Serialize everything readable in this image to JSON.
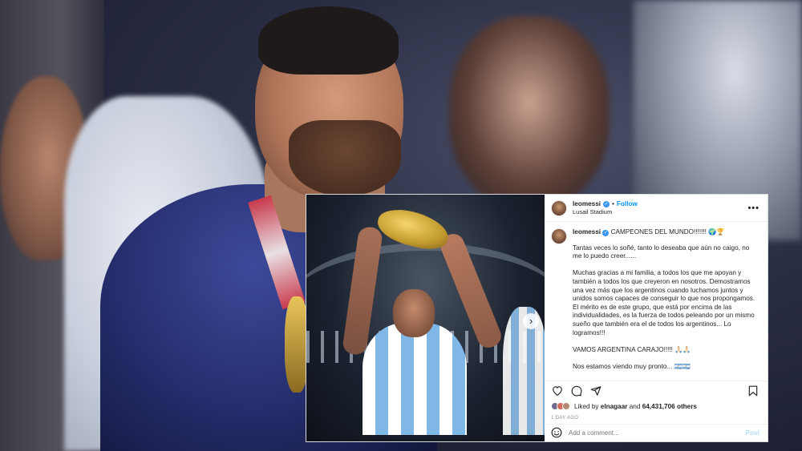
{
  "post": {
    "username": "leomessi",
    "follow_label": "Follow",
    "dot_separator": "•",
    "location": "Lusail Stadium",
    "more_icon": "•••",
    "caption_first": "CAMPEONES DEL MUNDO!!!!!!! 🌍🏆",
    "paragraphs": [
      "Tantas veces lo soñé, tanto lo deseaba que aún no caigo, no me lo puedo creer......",
      "Muchas gracias a mi familia, a todos los que me apoyan y también a todos los que creyeron en nosotros. Demostramos una vez más que los argentinos cuando luchamos juntos y unidos somos capaces de conseguir lo que nos propongamos. El mérito es de este grupo, que está por encima de las individualidades, es la fuerza de todos peleando por un mismo sueño que también era el de todos los argentinos... Lo logramos!!!",
      "VAMOS ARGENTINA CARAJO!!!!! 🙏🏻🙏🏻",
      "Nos estamos viendo muy pronto... 🇦🇷🇦🇷"
    ],
    "likes_prefix": "Liked by",
    "likes_user": "elnagaar",
    "likes_and": "and",
    "likes_count": "64,431,706 others",
    "time_ago": "1 DAY AGO",
    "comment_placeholder": "Add a comment...",
    "post_button": "Post"
  },
  "icons": {
    "verified": "verified-badge-icon",
    "next": "chevron-right-icon",
    "like": "heart-icon",
    "comment": "comment-icon",
    "share": "share-icon",
    "save": "bookmark-icon",
    "emoji": "smiley-icon"
  },
  "colors": {
    "follow_blue": "#0095f6",
    "verified_blue": "#3897f0",
    "muted_text": "#8e8e8e"
  }
}
